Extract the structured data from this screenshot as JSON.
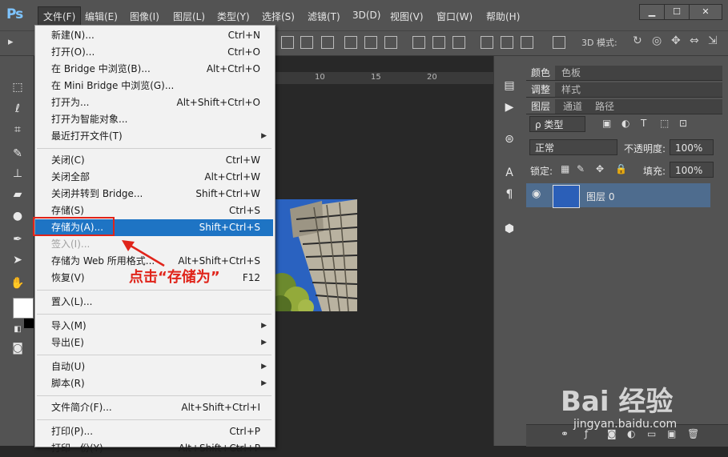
{
  "app": {
    "logo": "Ps"
  },
  "menubar": {
    "items": [
      "文件(F)",
      "编辑(E)",
      "图像(I)",
      "图层(L)",
      "类型(Y)",
      "选择(S)",
      "滤镜(T)",
      "3D(D)",
      "视图(V)",
      "窗口(W)",
      "帮助(H)"
    ],
    "active": "文件(F)"
  },
  "window_controls": {
    "minimize": "▁",
    "maximize": "☐",
    "close": "✕"
  },
  "optionsbar": {
    "mode_3d_label": "3D 模式:"
  },
  "ruler": {
    "ticks": [
      "10",
      "15",
      "20"
    ]
  },
  "file_menu": {
    "items": [
      {
        "label": "新建(N)...",
        "shortcut": "Ctrl+N"
      },
      {
        "label": "打开(O)...",
        "shortcut": "Ctrl+O"
      },
      {
        "label": "在 Bridge 中浏览(B)...",
        "shortcut": "Alt+Ctrl+O"
      },
      {
        "label": "在 Mini Bridge 中浏览(G)...",
        "shortcut": ""
      },
      {
        "label": "打开为...",
        "shortcut": "Alt+Shift+Ctrl+O"
      },
      {
        "label": "打开为智能对象...",
        "shortcut": ""
      },
      {
        "label": "最近打开文件(T)",
        "shortcut": "",
        "submenu": true
      },
      {
        "separator": true
      },
      {
        "label": "关闭(C)",
        "shortcut": "Ctrl+W"
      },
      {
        "label": "关闭全部",
        "shortcut": "Alt+Ctrl+W"
      },
      {
        "label": "关闭并转到 Bridge...",
        "shortcut": "Shift+Ctrl+W"
      },
      {
        "label": "存储(S)",
        "shortcut": "Ctrl+S"
      },
      {
        "label": "存储为(A)...",
        "shortcut": "Shift+Ctrl+S",
        "highlighted": true
      },
      {
        "label": "签入(I)...",
        "shortcut": "",
        "disabled": true
      },
      {
        "label": "存储为 Web 所用格式...",
        "shortcut": "Alt+Shift+Ctrl+S"
      },
      {
        "label": "恢复(V)",
        "shortcut": "F12"
      },
      {
        "separator": true
      },
      {
        "label": "置入(L)...",
        "shortcut": ""
      },
      {
        "separator": true
      },
      {
        "label": "导入(M)",
        "shortcut": "",
        "submenu": true
      },
      {
        "label": "导出(E)",
        "shortcut": "",
        "submenu": true
      },
      {
        "separator": true
      },
      {
        "label": "自动(U)",
        "shortcut": "",
        "submenu": true
      },
      {
        "label": "脚本(R)",
        "shortcut": "",
        "submenu": true
      },
      {
        "separator": true
      },
      {
        "label": "文件简介(F)...",
        "shortcut": "Alt+Shift+Ctrl+I"
      },
      {
        "separator": true
      },
      {
        "label": "打印(P)...",
        "shortcut": "Ctrl+P"
      },
      {
        "label": "打印一份(Y)",
        "shortcut": "Alt+Shift+Ctrl+P"
      }
    ]
  },
  "annotation": {
    "text": "点击“存储为”"
  },
  "panels": {
    "row1_tabs": [
      "颜色",
      "色板"
    ],
    "row2_tabs": [
      "调整",
      "样式"
    ],
    "row3_tabs": [
      "图层",
      "通道",
      "路径"
    ],
    "filter_kind": "ρ 类型",
    "blend_mode": "正常",
    "opacity_label": "不透明度:",
    "opacity_value": "100%",
    "lock_label": "锁定:",
    "fill_label": "填充:",
    "fill_value": "100%",
    "layer_name": "图层 0"
  },
  "watermark": {
    "brand": "Bai 经验",
    "url": "jingyan.baidu.com"
  },
  "colors": {
    "highlight": "#1e74c4",
    "annotation_red": "#e0241a",
    "layer_selected": "#4e6c8e"
  }
}
